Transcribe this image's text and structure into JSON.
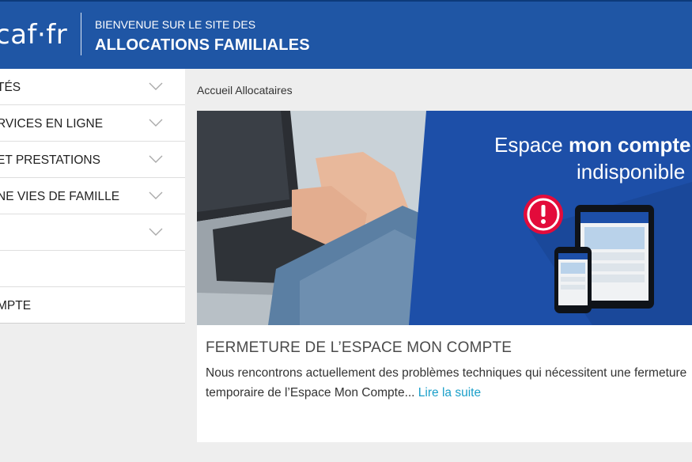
{
  "header": {
    "logo_text": "caf·fr",
    "welcome": "BIENVENUE SUR LE SITE DES",
    "site_name": "ALLOCATIONS FAMILIALES"
  },
  "sidebar": {
    "items": [
      {
        "label": "TÉS",
        "has_chevron": true
      },
      {
        "label": "RVICES EN LIGNE",
        "has_chevron": true
      },
      {
        "label": "ET PRESTATIONS",
        "has_chevron": true
      },
      {
        "label": "NE VIES DE FAMILLE",
        "has_chevron": true
      },
      {
        "label": "",
        "has_chevron": true
      },
      {
        "label": "",
        "has_chevron": false
      },
      {
        "label": "MPTE",
        "has_chevron": false
      }
    ]
  },
  "breadcrumb": "Accueil Allocataires",
  "article": {
    "banner_line1_prefix": "Espace ",
    "banner_line1_bold": "mon compte",
    "banner_line2": "indisponible",
    "title": "FERMETURE DE L’ESPACE MON COMPTE",
    "body": "Nous rencontrons actuellement des problèmes techniques qui nécessitent une fermeture temporaire de l’Espace Mon Compte...",
    "read_more": "Lire la suite"
  },
  "colors": {
    "header_blue": "#1f56a5",
    "banner_blue": "#1d4fa8",
    "link": "#1a9fc9",
    "alert_red": "#e30b3b"
  }
}
